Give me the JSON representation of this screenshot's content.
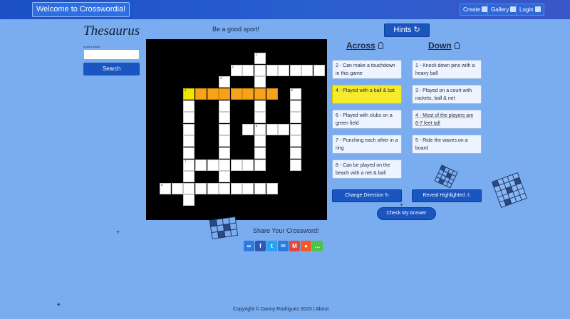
{
  "nav": {
    "brand": "Welcome to Crosswordia!",
    "create": "Create",
    "gallery": "Gallery",
    "login": "Login"
  },
  "thesaurus": {
    "title": "Thesaurus",
    "input_label": "Input a Word",
    "input_value": "",
    "search": "Search"
  },
  "puzzle": {
    "tagline": "Be a good sport!",
    "numbers": {
      "n1": "1",
      "n2": "2",
      "n3": "3",
      "n4": "4",
      "n5": "5",
      "n6": "6",
      "n7": "7",
      "n8": "8"
    }
  },
  "hints": {
    "label": "Hints ↻",
    "across_title": "Across",
    "down_title": "Down",
    "across": [
      "2 - Can make a touchdown in this game",
      "4 - Played with a ball & bat",
      "6 - Played with clubs on a green field",
      "7 - Punching each other in a ring",
      "8 - Can be played on the beach with a net & ball"
    ],
    "down": [
      "1 - Knock down pins with a heavy ball",
      "3 - Played on a court with rackets, ball & net",
      "4 - Most of the players are 6-7 feet tall",
      "5 - Ride the waves on a board"
    ]
  },
  "actions": {
    "change_direction": "Change Direction ↻",
    "reveal": "Reveal Highlighted ⚠",
    "check": "Check My Answer"
  },
  "share": {
    "title": "Share Your Crossword!"
  },
  "footer": {
    "copyright": "Copyright © Danny Rodriguez 2023 |",
    "about": "About"
  },
  "colors": {
    "background": "#7aacf0",
    "topbar": "#1b4fc4",
    "button": "#1a55c0",
    "highlight_word": "#f7a21b",
    "selected_cell": "#f2e600"
  }
}
